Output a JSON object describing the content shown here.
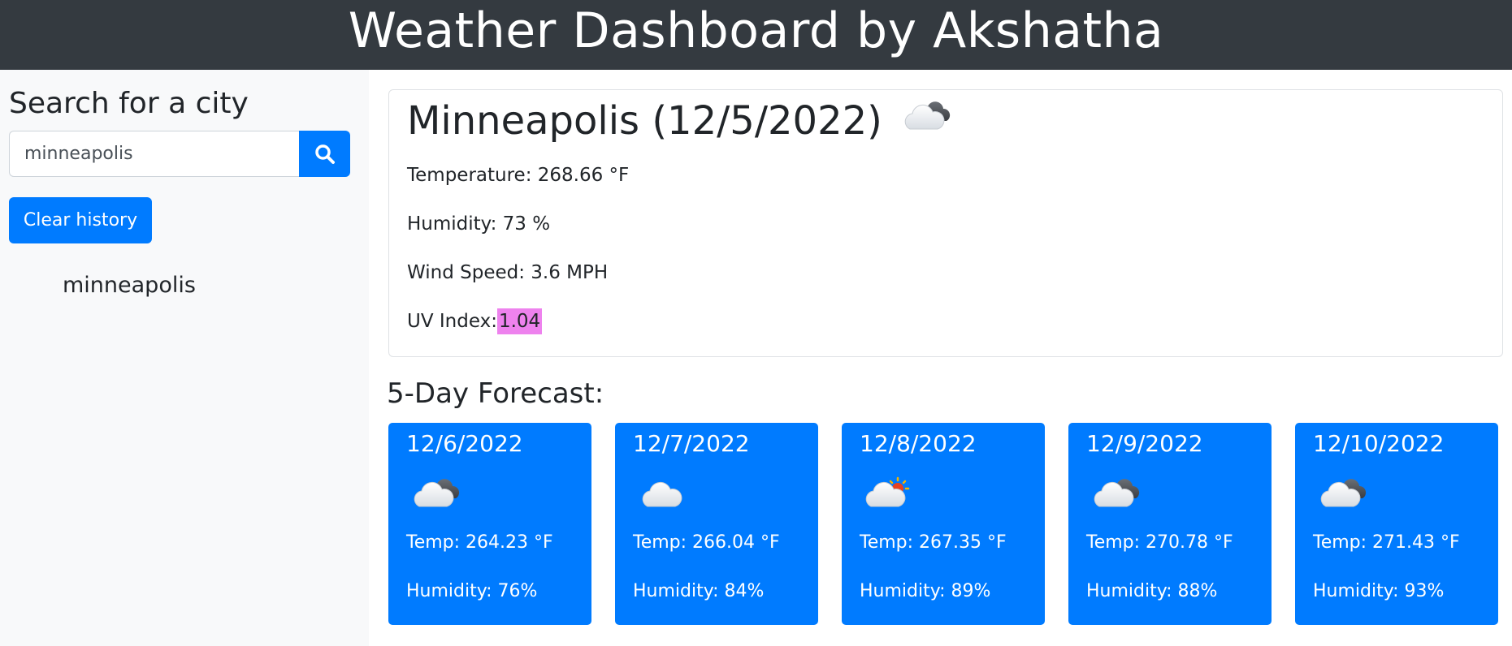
{
  "header": {
    "title": "Weather Dashboard by Akshatha"
  },
  "sidebar": {
    "heading": "Search for a city",
    "search_value": "minneapolis",
    "clear_label": "Clear history",
    "history": [
      "minneapolis"
    ]
  },
  "current": {
    "title": "Minneapolis (12/5/2022)",
    "icon": "cloud-icon",
    "temperature": "Temperature: 268.66 °F",
    "humidity": "Humidity: 73 %",
    "wind": "Wind Speed: 3.6 MPH",
    "uv_label": "UV Index:",
    "uv_value": "1.04"
  },
  "forecast": {
    "heading": "5-Day Forecast:",
    "days": [
      {
        "date": "12/6/2022",
        "icon": "cloud-icon",
        "temp": "Temp: 264.23 °F",
        "humidity": "Humidity: 76%"
      },
      {
        "date": "12/7/2022",
        "icon": "cloud-icon",
        "temp": "Temp: 266.04 °F",
        "humidity": "Humidity: 84%"
      },
      {
        "date": "12/8/2022",
        "icon": "partly-cloudy-sun-icon",
        "temp": "Temp: 267.35 °F",
        "humidity": "Humidity: 89%"
      },
      {
        "date": "12/9/2022",
        "icon": "cloud-icon",
        "temp": "Temp: 270.78 °F",
        "humidity": "Humidity: 88%"
      },
      {
        "date": "12/10/2022",
        "icon": "cloud-icon",
        "temp": "Temp: 271.43 °F",
        "humidity": "Humidity: 93%"
      }
    ]
  },
  "colors": {
    "header_bg": "#343a40",
    "primary": "#007bff",
    "sidebar_bg": "#f8f9fa",
    "uv_badge": "#ee82ee"
  }
}
